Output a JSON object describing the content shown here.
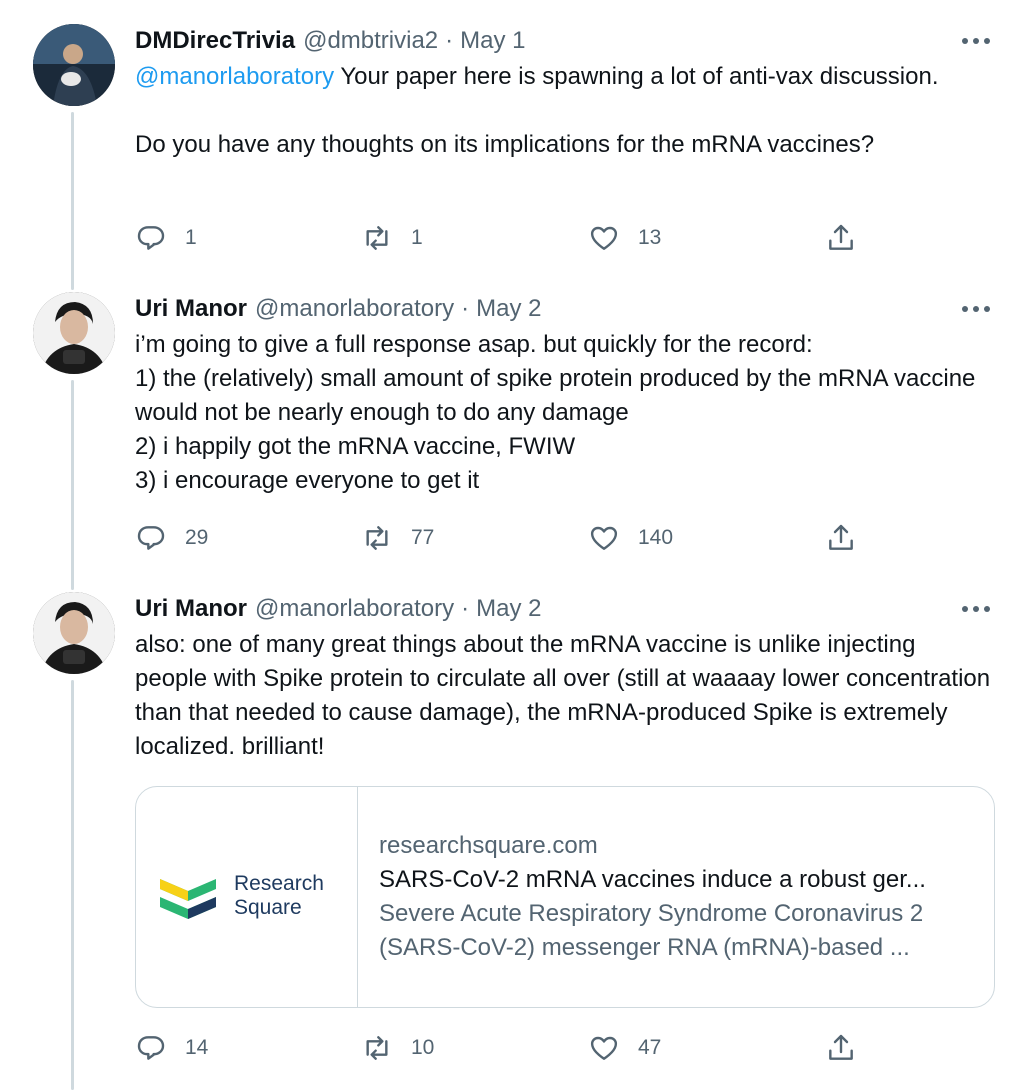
{
  "tweets": [
    {
      "name": "DMDirecTrivia",
      "handle": "@dmbtrivia2",
      "separator": "·",
      "date": "May 1",
      "mention": "@manorlaboratory",
      "text": " Your paper here is spawning a lot of anti-vax discussion.\n\nDo you have any thoughts on its implications for the mRNA vaccines?",
      "replies": "1",
      "retweets": "1",
      "likes": "13"
    },
    {
      "name": "Uri Manor",
      "handle": "@manorlaboratory",
      "separator": "·",
      "date": "May 2",
      "text": "i’m going to give a full response asap. but quickly for the record:\n1) the (relatively) small amount of spike protein produced by the mRNA vaccine would not be nearly enough to do any damage\n2) i happily got the mRNA vaccine, FWIW\n3) i encourage everyone to get it",
      "replies": "29",
      "retweets": "77",
      "likes": "140"
    },
    {
      "name": "Uri Manor",
      "handle": "@manorlaboratory",
      "separator": "·",
      "date": "May 2",
      "text": "also: one of many great things about the mRNA vaccine is unlike injecting people with Spike protein to circulate all over (still at waaaay lower concentration than that needed to cause damage), the mRNA-produced Spike is extremely localized. brilliant!",
      "replies": "14",
      "retweets": "10",
      "likes": "47",
      "card": {
        "logo_line1": "Research",
        "logo_line2": "Square",
        "domain": "researchsquare.com",
        "title": "SARS-CoV-2 mRNA vaccines induce a robust ger...",
        "description_line1": "Severe Acute Respiratory Syndrome Coronavirus 2",
        "description_line2": "(SARS-CoV-2) messenger RNA (mRNA)-based ..."
      }
    }
  ],
  "icons": {
    "reply": "reply-icon",
    "retweet": "retweet-icon",
    "like": "heart-icon",
    "share": "share-icon",
    "more": "more-icon"
  },
  "colors": {
    "text": "#0f1419",
    "secondary": "#536471",
    "link": "#1d9bf0",
    "border": "#cfd9de",
    "logo_green": "#2bb673",
    "logo_yellow": "#f7d117",
    "logo_navy": "#1e3a5f"
  }
}
